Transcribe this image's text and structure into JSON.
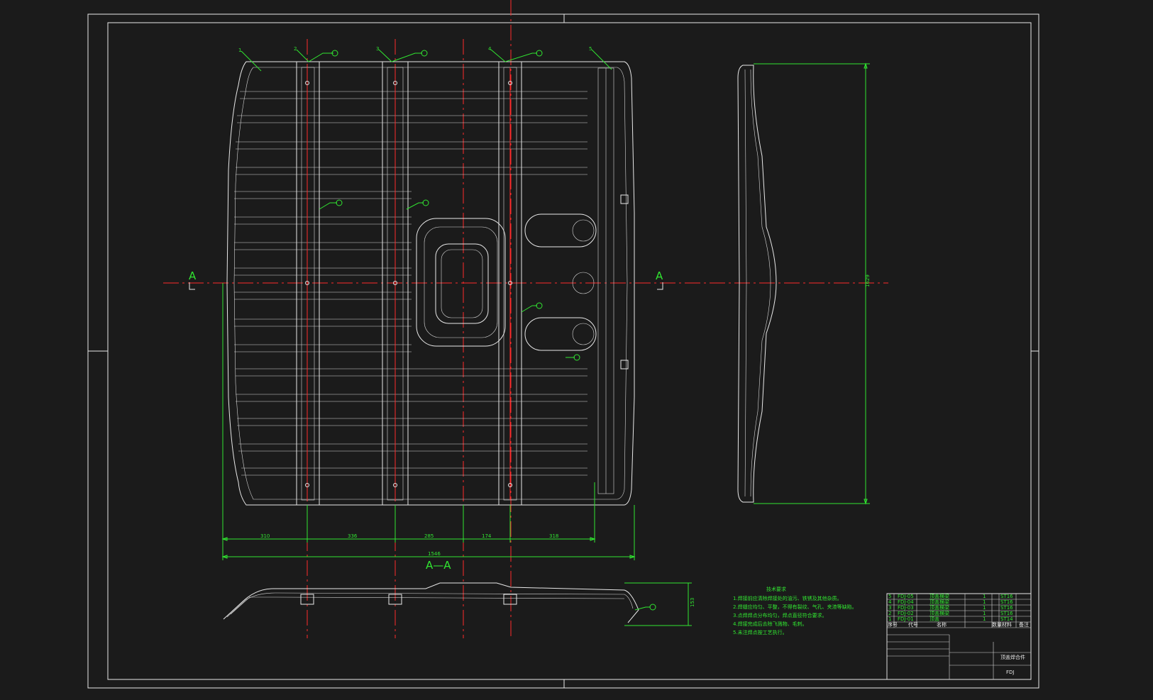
{
  "drawing": {
    "section_labels": {
      "left": "A",
      "right": "A",
      "section_title": "A—A"
    },
    "dimensions_bottom": [
      "310",
      "336",
      "285",
      "174",
      "318"
    ],
    "dimension_overall": "1546",
    "dimension_side_height": "1629",
    "dimension_section_height": "153",
    "part_callouts": [
      "1",
      "2",
      "3",
      "4",
      "5"
    ],
    "tech_requirements": {
      "title": "技术要求",
      "lines": [
        "1.焊接前应清除焊接处的油污、铁锈及其他杂质。",
        "2.焊缝应均匀、平整，不得有裂纹、气孔、夹渣等缺陷。",
        "3.点焊焊点分布均匀，焊点直径符合要求。",
        "4.焊接完成后去除飞溅物、毛刺。",
        "5.未注焊点按工艺执行。"
      ]
    },
    "parts_list": {
      "rows": [
        {
          "no": "5",
          "code": "FDJ-05",
          "name": "顶盖横梁",
          "qty": "1",
          "material": "ST16"
        },
        {
          "no": "4",
          "code": "FDJ-04",
          "name": "顶盖横梁",
          "qty": "1",
          "material": "ST16"
        },
        {
          "no": "3",
          "code": "FDJ-03",
          "name": "顶盖横梁",
          "qty": "1",
          "material": "ST16"
        },
        {
          "no": "2",
          "code": "FDJ-02",
          "name": "顶盖横梁",
          "qty": "1",
          "material": "ST16"
        },
        {
          "no": "1",
          "code": "FDJ-01",
          "name": "顶盖",
          "qty": "1",
          "material": "ST14"
        }
      ],
      "headers": [
        "序号",
        "代号",
        "名称",
        "数量",
        "材料",
        "备注"
      ]
    },
    "title_block": {
      "drawing_name": "顶盖焊合件",
      "drawing_code": "FDJ"
    }
  }
}
